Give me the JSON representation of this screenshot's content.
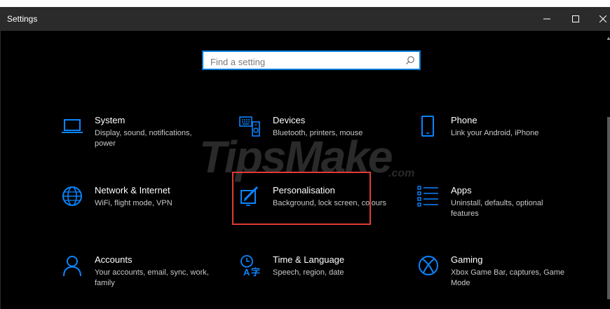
{
  "window": {
    "title": "Settings"
  },
  "search": {
    "placeholder": "Find a setting"
  },
  "tiles": [
    {
      "name": "System",
      "desc": "Display, sound, notifications, power",
      "icon": "laptop-icon"
    },
    {
      "name": "Devices",
      "desc": "Bluetooth, printers, mouse",
      "icon": "keyboard-speaker-icon"
    },
    {
      "name": "Phone",
      "desc": "Link your Android, iPhone",
      "icon": "phone-icon"
    },
    {
      "name": "Network & Internet",
      "desc": "WiFi, flight mode, VPN",
      "icon": "globe-icon"
    },
    {
      "name": "Personalisation",
      "desc": "Background, lock screen, colours",
      "icon": "paint-brush-icon"
    },
    {
      "name": "Apps",
      "desc": "Uninstall, defaults, optional features",
      "icon": "apps-list-icon"
    },
    {
      "name": "Accounts",
      "desc": "Your accounts, email, sync, work, family",
      "icon": "person-icon"
    },
    {
      "name": "Time & Language",
      "desc": "Speech, region, date",
      "icon": "time-language-icon"
    },
    {
      "name": "Gaming",
      "desc": "Xbox Game Bar, captures, Game Mode",
      "icon": "xbox-icon"
    }
  ],
  "colors": {
    "accent": "#0078d7",
    "highlight": "#e23b35",
    "background": "#000000",
    "titlebar": "#2b2b2b"
  },
  "watermark": "TipsMake.com"
}
